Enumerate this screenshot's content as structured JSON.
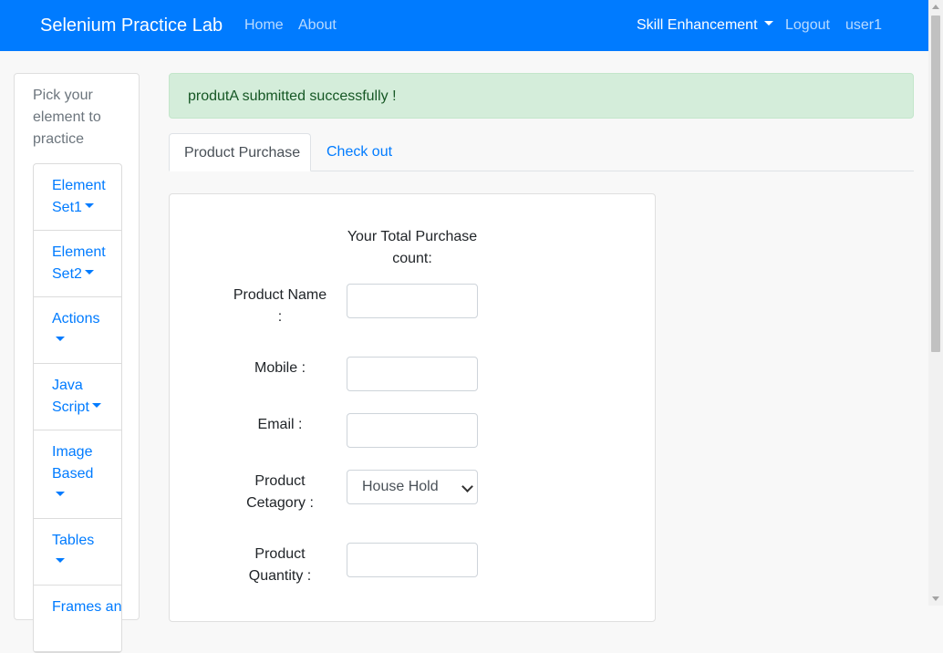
{
  "navbar": {
    "brand": "Selenium Practice Lab",
    "links": [
      "Home",
      "About"
    ],
    "dropdown_label": "Skill Enhancement",
    "logout": "Logout",
    "user": "user1"
  },
  "sidebar": {
    "title": "Pick your element to practice",
    "items": [
      {
        "label": "Element Set1"
      },
      {
        "label": "Element Set2"
      },
      {
        "label": "Actions"
      },
      {
        "label": "Java Script"
      },
      {
        "label": "Image Based"
      },
      {
        "label": "Tables"
      },
      {
        "label": "Frames and"
      }
    ]
  },
  "alert": {
    "message": "produtA submitted successfully !"
  },
  "tabs": [
    {
      "label": "Product Purchase",
      "active": true
    },
    {
      "label": "Check out",
      "active": false
    }
  ],
  "form": {
    "total_label": "Your Total Purchase count:",
    "product_name_label": "Product Name :",
    "mobile_label": "Mobile :",
    "email_label": "Email :",
    "category_label": "Product Cetagory :",
    "category_selected": "House Hold",
    "quantity_label": "Product Quantity :",
    "product_name_value": "",
    "mobile_value": "",
    "email_value": "",
    "quantity_value": ""
  },
  "colors": {
    "primary": "#007bff",
    "alert_bg": "#d4edda",
    "alert_text": "#155724"
  }
}
